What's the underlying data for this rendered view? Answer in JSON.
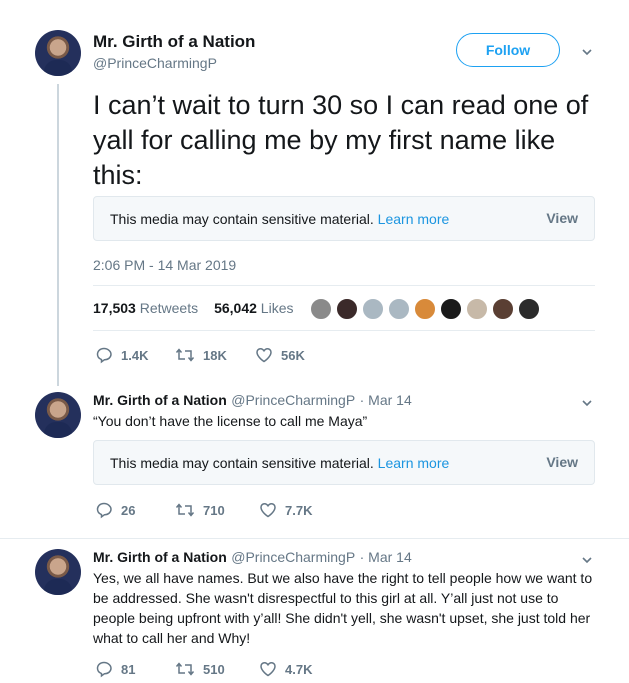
{
  "main_tweet": {
    "display_name": "Mr. Girth of a Nation",
    "handle": "@PrinceCharmingP",
    "follow_label": "Follow",
    "text": "I can’t wait to turn 30 so I can read one of yall for calling me by my first name like this:",
    "media_warning": "This media may contain sensitive material.",
    "media_learn_more": "Learn more",
    "media_view": "View",
    "timestamp": "2:06 PM - 14 Mar 2019",
    "retweets_count": "17,503",
    "retweets_label": "Retweets",
    "likes_count": "56,042",
    "likes_label": "Likes",
    "liker_colors": [
      "#8a8a8a",
      "#3b2a2a",
      "#aab8c2",
      "#aab8c2",
      "#d88a3a",
      "#1a1a1a",
      "#c7b9a8",
      "#5a3f33",
      "#2b2b2b"
    ],
    "actions": {
      "replies": "1.4K",
      "retweets": "18K",
      "likes": "56K"
    }
  },
  "reply1": {
    "display_name": "Mr. Girth of a Nation",
    "handle": "@PrinceCharmingP",
    "date": "· Mar 14",
    "text": "“You don’t have the license to call me Maya”",
    "media_warning": "This media may contain sensitive material.",
    "media_learn_more": "Learn more",
    "media_view": "View",
    "actions": {
      "replies": "26",
      "retweets": "710",
      "likes": "7.7K"
    }
  },
  "reply2": {
    "display_name": "Mr. Girth of a Nation",
    "handle": "@PrinceCharmingP",
    "date": "· Mar 14",
    "text": "Yes, we all have names. But we also have the right to tell people how we want to be addressed. She wasn't disrespectful to this girl at all. Y’all just not use to people being upfront with y’all! She didn't yell, she wasn't upset, she just told her what to call her and Why!",
    "actions": {
      "replies": "81",
      "retweets": "510",
      "likes": "4.7K"
    }
  },
  "colors": {
    "accent": "#1da1f2",
    "muted": "#657786",
    "text": "#14171a"
  }
}
